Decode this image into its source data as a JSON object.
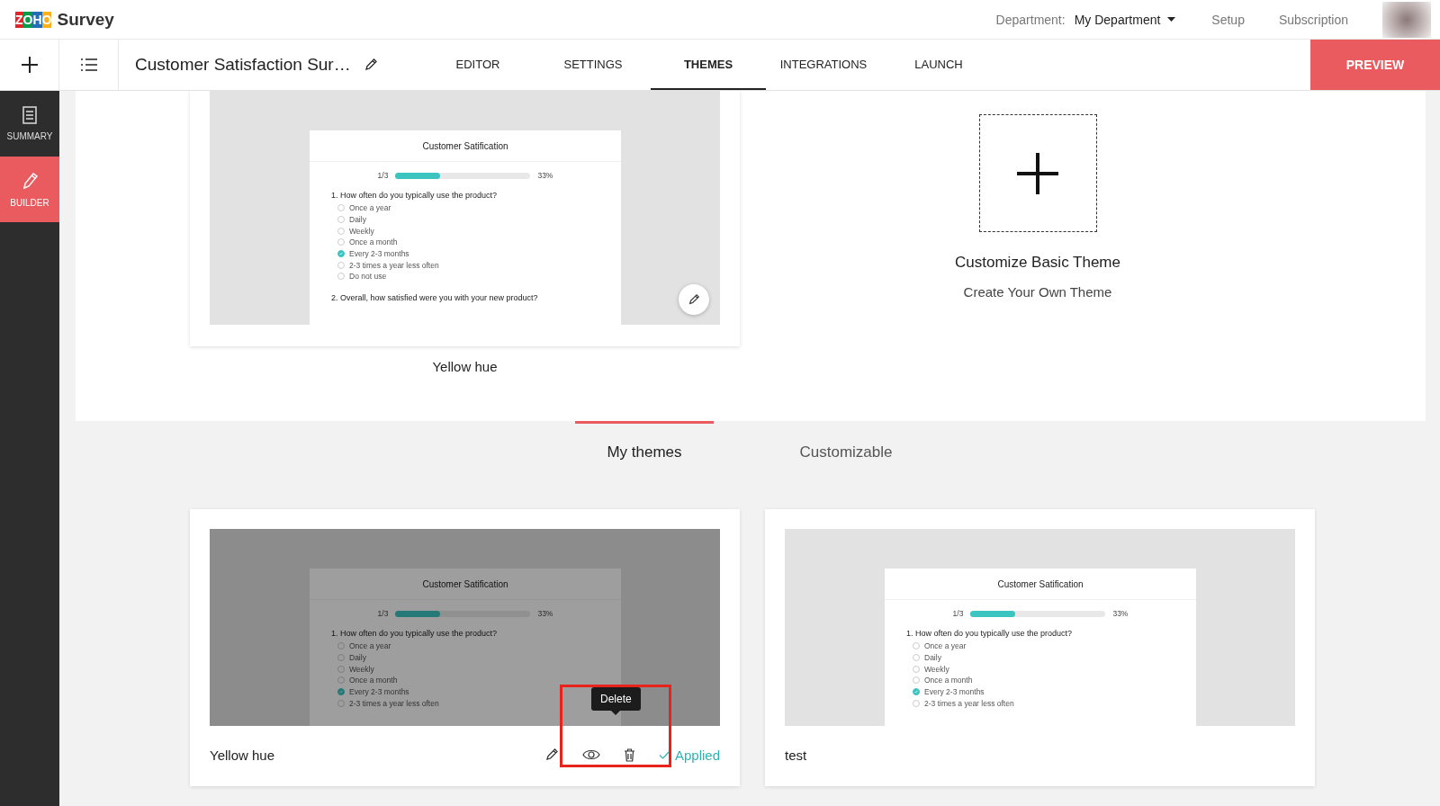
{
  "header": {
    "logo": "ZOHO",
    "product": "Survey",
    "department_label": "Department:",
    "department_value": "My Department",
    "links": [
      "Setup",
      "Subscription"
    ]
  },
  "toolbar": {
    "survey_title": "Customer Satisfaction Sur…",
    "tabs": [
      {
        "label": "EDITOR",
        "selected": false
      },
      {
        "label": "SETTINGS",
        "selected": false
      },
      {
        "label": "THEMES",
        "selected": true
      },
      {
        "label": "INTEGRATIONS",
        "selected": false
      },
      {
        "label": "LAUNCH",
        "selected": false
      }
    ],
    "preview_button": "PREVIEW"
  },
  "sidebar": {
    "items": [
      {
        "label": "SUMMARY",
        "kind": "summary",
        "selected": false
      },
      {
        "label": "BUILDER",
        "kind": "builder",
        "selected": true
      }
    ]
  },
  "featured": {
    "theme": {
      "name": "Yellow hue",
      "preview": {
        "title": "Customer Satification",
        "progress_label": "1/3",
        "level": 0.33,
        "percent": "33%",
        "question": "1. How often do you typically use the product?",
        "options": [
          {
            "label": "Once a year",
            "selected": false
          },
          {
            "label": "Daily",
            "selected": false
          },
          {
            "label": "Weekly",
            "selected": false
          },
          {
            "label": "Once a month",
            "selected": false
          },
          {
            "label": "Every 2-3 months",
            "selected": true
          },
          {
            "label": "2-3 times a year less often",
            "selected": false
          },
          {
            "label": "Do not use",
            "selected": false
          }
        ],
        "question_2": "2. Overall, how satisfied were you with your new product?"
      }
    },
    "customize": {
      "title": "Customize Basic Theme",
      "subtitle": "Create Your Own Theme"
    }
  },
  "section_tabs": [
    {
      "label": "My themes",
      "selected": true
    },
    {
      "label": "Customizable",
      "selected": false
    }
  ],
  "my_themes": [
    {
      "name": "Yellow hue",
      "hovered": true,
      "applied": true,
      "applied_label": "Applied",
      "tooltip": "Delete",
      "highlighted": true,
      "preview": {
        "title": "Customer Satification",
        "progress_label": "1/3",
        "level": 0.33,
        "percent": "33%",
        "question": "1. How often do you typically use the product?",
        "options": [
          {
            "label": "Once a year",
            "selected": false
          },
          {
            "label": "Daily",
            "selected": false
          },
          {
            "label": "Weekly",
            "selected": false
          },
          {
            "label": "Once a month",
            "selected": false
          },
          {
            "label": "Every 2-3 months",
            "selected": true
          },
          {
            "label": "2-3 times a year less often",
            "selected": false
          }
        ]
      }
    },
    {
      "name": "test",
      "hovered": false,
      "applied": false,
      "highlighted": false,
      "preview": {
        "title": "Customer Satification",
        "progress_label": "1/3",
        "level": 0.33,
        "percent": "33%",
        "question": "1. How often do you typically use the product?",
        "options": [
          {
            "label": "Once a year",
            "selected": false
          },
          {
            "label": "Daily",
            "selected": false
          },
          {
            "label": "Weekly",
            "selected": false
          },
          {
            "label": "Once a month",
            "selected": false
          },
          {
            "label": "Every 2-3 months",
            "selected": true
          },
          {
            "label": "2-3 times a year less often",
            "selected": false
          }
        ]
      }
    }
  ]
}
